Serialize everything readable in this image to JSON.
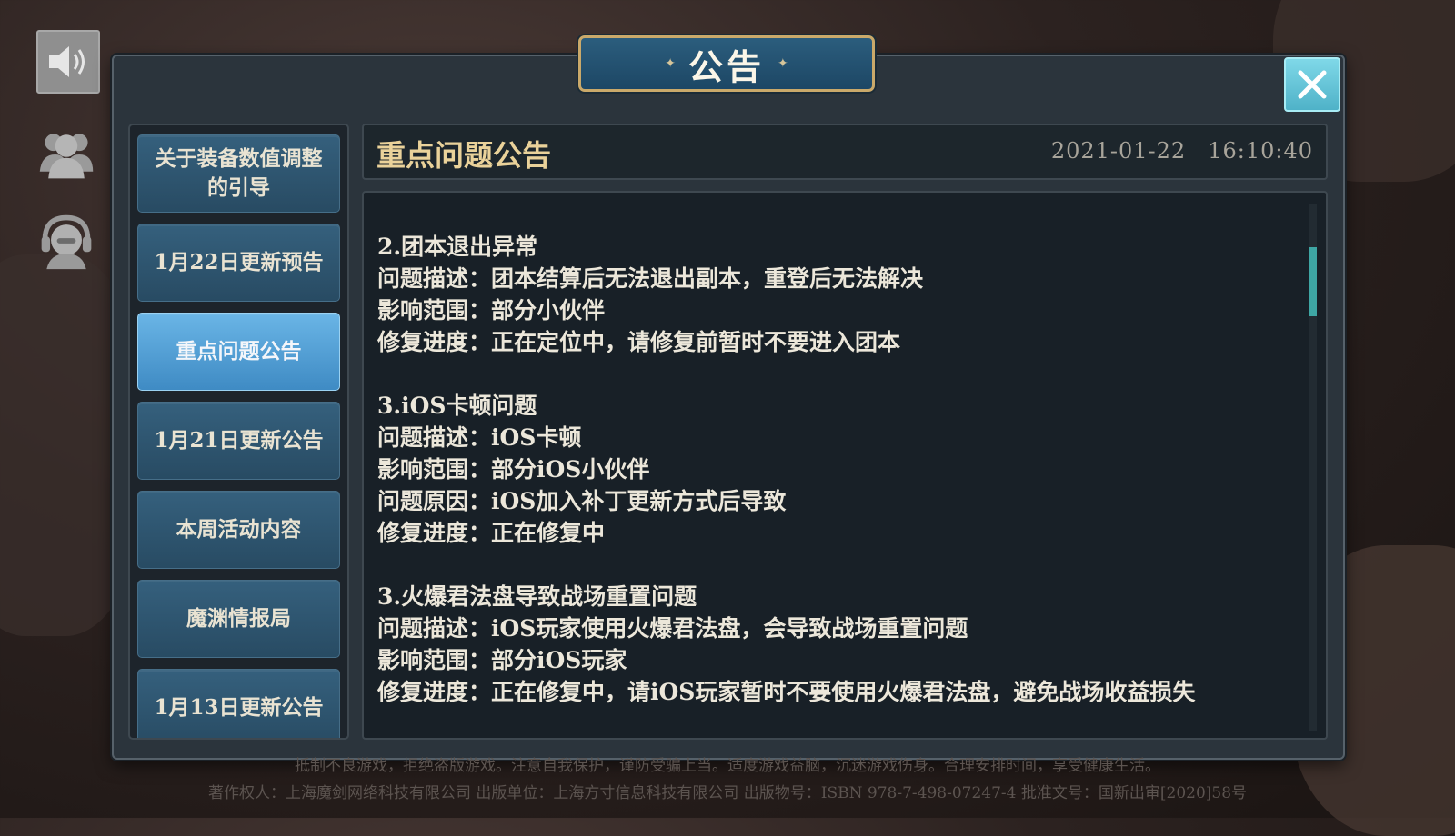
{
  "dialog": {
    "title": "公告",
    "title_deco_left": "✦",
    "title_deco_right": "✦"
  },
  "sidebar_icons": {
    "sound": "speaker-icon",
    "friends": "friends-icon",
    "service": "customer-service-icon"
  },
  "tabs": [
    {
      "label": "关于装备数值调整的引导",
      "active": false
    },
    {
      "label": "1月22日更新预告",
      "active": false
    },
    {
      "label": "重点问题公告",
      "active": true
    },
    {
      "label": "1月21日更新公告",
      "active": false
    },
    {
      "label": "本周活动内容",
      "active": false
    },
    {
      "label": "魔渊情报局",
      "active": false
    },
    {
      "label": "1月13日更新公告",
      "active": false
    }
  ],
  "header": {
    "title": "重点问题公告",
    "date": "2021-01-22",
    "time": "16:10:40"
  },
  "content": {
    "blocks": [
      {
        "lines": [
          "2.团本退出异常",
          "问题描述：团本结算后无法退出副本，重登后无法解决",
          "影响范围：部分小伙伴",
          "修复进度：正在定位中，请修复前暂时不要进入团本"
        ]
      },
      {
        "lines": [
          "3.iOS卡顿问题",
          "问题描述：iOS卡顿",
          "影响范围：部分iOS小伙伴",
          "问题原因：iOS加入补丁更新方式后导致",
          "修复进度：正在修复中"
        ]
      },
      {
        "lines": [
          "3.火爆君法盘导致战场重置问题",
          "问题描述：iOS玩家使用火爆君法盘，会导致战场重置问题",
          "影响范围：部分iOS玩家",
          "修复进度：正在修复中，请iOS玩家暂时不要使用火爆君法盘，避免战场收益损失"
        ]
      }
    ]
  },
  "footer": {
    "line1": "抵制不良游戏，拒绝盗版游戏。注意自我保护，谨防受骗上当。适度游戏益脑，沉迷游戏伤身。合理安排时间，享受健康生活。",
    "line2": "著作权人：上海魔剑网络科技有限公司   出版单位：上海方寸信息科技有限公司   出版物号：ISBN 978-7-498-07247-4   批准文号：国新出审[2020]58号"
  },
  "colors": {
    "accent": "#3ea6a4",
    "active_tab": "#4f9fd6",
    "header_title": "#ead29a"
  }
}
